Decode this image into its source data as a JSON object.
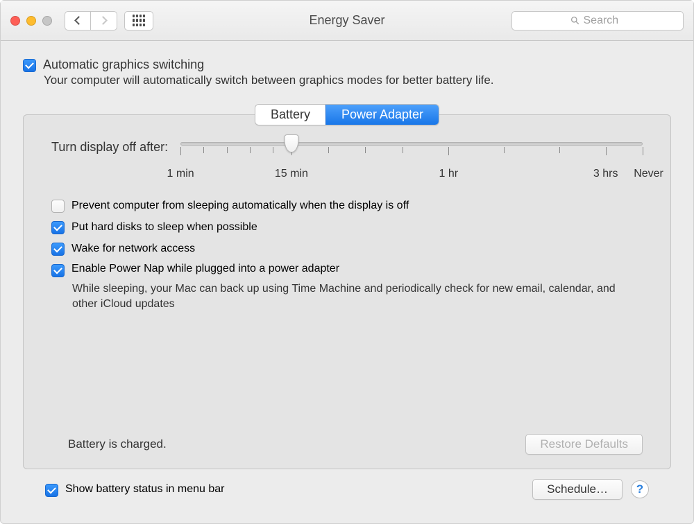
{
  "window": {
    "title": "Energy Saver"
  },
  "search": {
    "placeholder": "Search"
  },
  "auto_graphics": {
    "checked": true,
    "label": "Automatic graphics switching",
    "desc": "Your computer will automatically switch between graphics modes for better battery life."
  },
  "tabs": {
    "battery": "Battery",
    "power_adapter": "Power Adapter",
    "active": "power_adapter"
  },
  "slider": {
    "label": "Turn display off after:",
    "value_pct": 24,
    "labels": {
      "min": "1 min",
      "fifteen": "15 min",
      "hour": "1 hr",
      "threehr": "3 hrs",
      "never": "Never"
    }
  },
  "options": {
    "prevent_sleep": {
      "checked": false,
      "label": "Prevent computer from sleeping automatically when the display is off"
    },
    "hard_disks": {
      "checked": true,
      "label": "Put hard disks to sleep when possible"
    },
    "wake_network": {
      "checked": true,
      "label": "Wake for network access"
    },
    "power_nap": {
      "checked": true,
      "label": "Enable Power Nap while plugged into a power adapter",
      "desc": "While sleeping, your Mac can back up using Time Machine and periodically check for new email, calendar, and other iCloud updates"
    }
  },
  "status": "Battery is charged.",
  "buttons": {
    "restore": "Restore Defaults",
    "schedule": "Schedule…"
  },
  "bottom": {
    "show_menu_bar": {
      "checked": true,
      "label": "Show battery status in menu bar"
    }
  },
  "help": "?"
}
